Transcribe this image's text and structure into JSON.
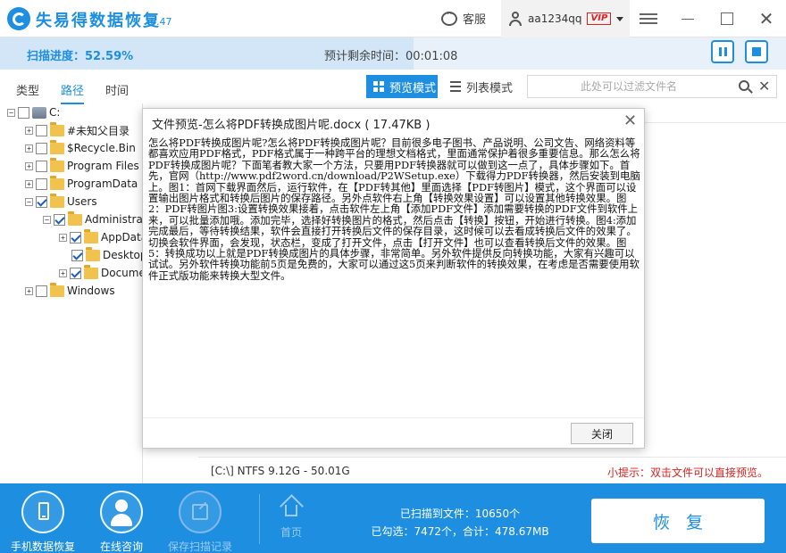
{
  "app": {
    "title": "失易得数据恢复",
    "version": "6.47"
  },
  "header": {
    "service_label": "客服",
    "username": "aa1234qq",
    "vip_label": "VIP"
  },
  "scan": {
    "progress_label": "扫描进度：52.59%",
    "progress_percent": 52.59,
    "remaining_label": "预计剩余时间：00:01:08"
  },
  "tabs": [
    {
      "label": "类型",
      "active": false
    },
    {
      "label": "路径",
      "active": true
    },
    {
      "label": "时间",
      "active": false
    }
  ],
  "view": {
    "preview_label": "预览模式",
    "list_label": "列表模式",
    "filter_placeholder": "此处可以过滤文件名"
  },
  "tree": {
    "root": "C:",
    "items": [
      "#未知父目录",
      "$Recycle.Bin",
      "Program Files",
      "ProgramData",
      "Users",
      "Administrator",
      "AppData",
      "Desktop",
      "Documents",
      "Windows"
    ]
  },
  "dialog": {
    "title": "文件预览-怎么将PDF转换成图片呢.docx ( 17.47KB )",
    "close_label": "关闭",
    "content": "怎么将PDF转换成图片呢?怎么将PDF转换成图片呢？目前很多电子图书、产品说明、公司文告、网络资料等都喜欢应用PDF格式，PDF格式属于一种跨平台的理想文档格式，里面通常保护着很多重要信息。那么怎么将PDF转换成图片呢？下面笔者教大家一个方法，只要用PDF转换器就可以做到这一点了，具体步骤如下。首先，官网（http://www.pdf2word.cn/download/P2WSetup.exe）下载得力PDF转换器，然后安装到电脑上。图1：首网下载界面然后，运行软件，在【PDF转其他】里面选择【PDF转图片】模式，这个界面可以设置输出图片格式和转换后图片的保存路径。另外点软件右上角【转换效果设置】可以设置其他转换效果。图2：PDF转图片图3:设置转换效果接着，点击软件左上角【添加PDF文件】添加需要转换的PDF文件到软件上来，可以批量添加哦。添加完毕，选择好转换图片的格式，然后点击【转换】按钮，开始进行转换。图4:添加完成最后，等待转换结果，软件会直接打开转换后文件的保存目录，这时候可以去看成转换后文件的效果了。切换会软件界面，会发现，状态栏，变成了打开文件，点击【打开文件】也可以查看转换后文件的效果。图5：转换成功以上就是PDF转换成图片的具体步骤，非常简单。另外软件提供反向转换功能，大家有兴趣可以试试。另外软件转换功能前5页是免费的，大家可以通过这5页来判断软件的转换效果，在考虑是否需要使用软件正式版功能来转换大型文件。"
  },
  "status": {
    "volume_info": "[C:\\] NTFS 9.12G - 50.01G",
    "hint": "小提示：双击文件可以直接预览。"
  },
  "bottom": {
    "phone_recovery_label": "手机数据恢复",
    "consult_label": "在线咨询",
    "save_record_label": "保存扫描记录",
    "home_label": "首页",
    "scanned_label": "已扫描到文件：10650个",
    "selected_label": "已勾选：7472个，合计：478.67MB",
    "recover_label": "恢复"
  },
  "colors": {
    "accent": "#1e8fe0",
    "hint_red": "#e02020"
  }
}
